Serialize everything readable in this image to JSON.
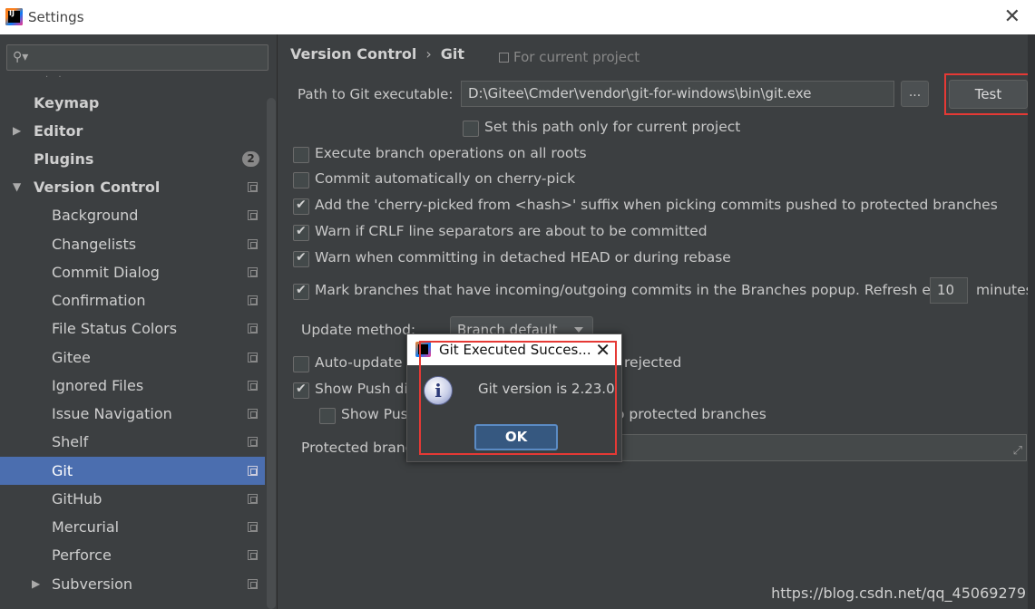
{
  "window": {
    "title": "Settings",
    "close": "✕"
  },
  "sidebar": {
    "search_placeholder": "",
    "items": [
      {
        "label": "Keymap"
      },
      {
        "label": "Editor"
      },
      {
        "label": "Plugins",
        "badge": "2"
      },
      {
        "label": "Version Control"
      },
      {
        "label": "Background"
      },
      {
        "label": "Changelists"
      },
      {
        "label": "Commit Dialog"
      },
      {
        "label": "Confirmation"
      },
      {
        "label": "File Status Colors"
      },
      {
        "label": "Gitee"
      },
      {
        "label": "Ignored Files"
      },
      {
        "label": "Issue Navigation"
      },
      {
        "label": "Shelf"
      },
      {
        "label": "Git",
        "selected": true
      },
      {
        "label": "GitHub"
      },
      {
        "label": "Mercurial"
      },
      {
        "label": "Perforce"
      },
      {
        "label": "Subversion"
      }
    ]
  },
  "breadcrumb": {
    "parent": "Version Control",
    "current": "Git",
    "scope": "For current project"
  },
  "git": {
    "path_label": "Path to Git executable:",
    "path_value": "D:\\Gitee\\Cmder\\vendor\\git-for-windows\\bin\\git.exe",
    "browse_label": "...",
    "test_label": "Test",
    "set_path_only": "Set this path only for current project",
    "options": [
      {
        "label": "Execute branch operations on all roots",
        "checked": false
      },
      {
        "label": "Commit automatically on cherry-pick",
        "checked": false
      },
      {
        "label": "Add the 'cherry-picked from <hash>' suffix when picking commits pushed to protected branches",
        "checked": true
      },
      {
        "label": "Warn if CRLF line separators are about to be committed",
        "checked": true
      },
      {
        "label": "Warn when committing in detached HEAD or during rebase",
        "checked": true
      },
      {
        "label": "Mark branches that have incoming/outgoing commits in the Branches popup.  Refresh every",
        "checked": true
      }
    ],
    "refresh_value": "10",
    "minutes_label": "minutes",
    "update_method_label": "Update method:",
    "update_method_value": "Branch default",
    "auto_update_label": "Auto-update i",
    "auto_update_suffix": "rejected",
    "show_push_label": "Show Push dia",
    "show_push_sub_label": "Show Push",
    "show_push_sub_suffix": "o protected branches",
    "protected_label": "Protected branc"
  },
  "dialog": {
    "title": "Git Executed Succes...",
    "message": "Git version is 2.23.0",
    "ok_label": "OK",
    "close": "✕"
  },
  "watermark": "https://blog.csdn.net/qq_45069279"
}
